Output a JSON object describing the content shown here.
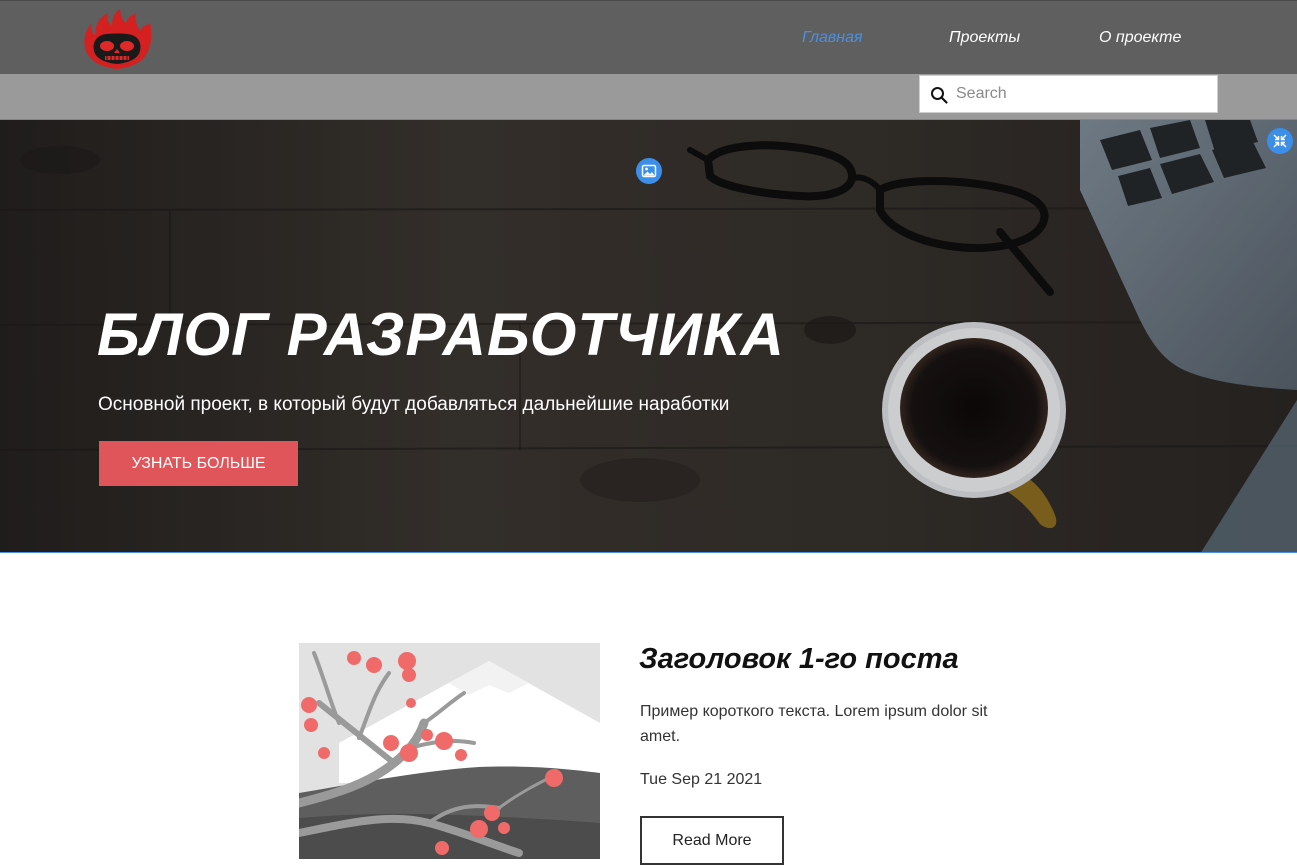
{
  "nav": {
    "links": [
      {
        "label": "Главная",
        "active": true
      },
      {
        "label": "Проекты",
        "active": false
      },
      {
        "label": "О проекте",
        "active": false
      }
    ]
  },
  "search": {
    "placeholder": "Search",
    "value": ""
  },
  "hero": {
    "title": "БЛОГ РАЗРАБОТЧИКА",
    "subtitle": "Основной проект, в который будут добавляться дальнейшие наработки",
    "button_label": "УЗНАТЬ БОЛЬШЕ"
  },
  "post": {
    "title": "Заголовок 1-го поста",
    "excerpt": "Пример короткого текста. Lorem ipsum dolor sit amet.",
    "date": "Tue Sep 21 2021",
    "read_more_label": "Read More"
  },
  "colors": {
    "nav_bg": "#5f5f5f",
    "search_strip_bg": "#9a9a9a",
    "active_link": "#4a90e2",
    "accent_button": "#e0555a",
    "edit_badge": "#3b8fe8"
  },
  "icons": {
    "logo": "flaming-skull-logo",
    "search": "search-icon",
    "hero_image_edit": "image-icon",
    "hero_collapse": "collapse-icon"
  }
}
